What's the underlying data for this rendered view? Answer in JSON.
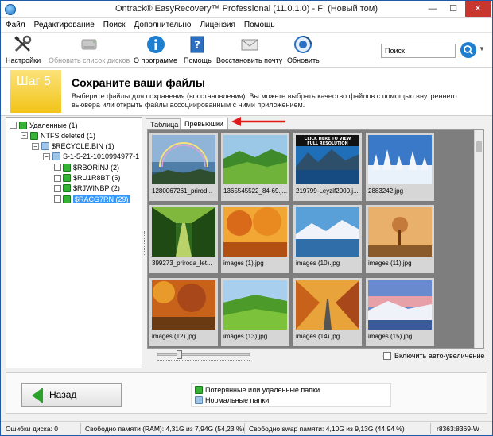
{
  "window": {
    "title": "Ontrack® EasyRecovery™ Professional (11.0.1.0) - F: (Новый том)",
    "min": "—",
    "max": "☐",
    "close": "✕"
  },
  "menu": [
    "Файл",
    "Редактирование",
    "Поиск",
    "Дополнительно",
    "Лицензия",
    "Помощь"
  ],
  "toolbar": {
    "items": [
      {
        "label": "Настройки",
        "icon": "wrench-screwdriver-icon",
        "enabled": true
      },
      {
        "label": "Обновить список дисков",
        "icon": "disk-drive-icon",
        "enabled": false
      },
      {
        "label": "О программе",
        "icon": "info-icon",
        "enabled": true
      },
      {
        "label": "Помощь",
        "icon": "help-book-icon",
        "enabled": true
      },
      {
        "label": "Восстановить почту",
        "icon": "envelope-icon",
        "enabled": true
      },
      {
        "label": "Обновить",
        "icon": "update-globe-icon",
        "enabled": true
      }
    ],
    "search_placeholder": "Поиск"
  },
  "step": {
    "badge": "Шаг 5",
    "title": "Сохраните ваши файлы",
    "description": "Выберите файлы для сохранения (восстановления). Вы можете выбрать качество файлов с помощью внутреннего вьювера или открыть файлы ассоциированным с ними приложением."
  },
  "tree": [
    {
      "label": "Удаленные (1)",
      "level": 0,
      "expander": "−",
      "color": "green",
      "checkbox": false,
      "selected": false
    },
    {
      "label": "NTFS deleted (1)",
      "level": 1,
      "expander": "−",
      "color": "green",
      "checkbox": false,
      "selected": false
    },
    {
      "label": "$RECYCLE.BIN (1)",
      "level": 2,
      "expander": "−",
      "color": "blue",
      "checkbox": false,
      "selected": false
    },
    {
      "label": "S-1-5-21-1010994977-1",
      "level": 3,
      "expander": "−",
      "color": "blue",
      "checkbox": false,
      "selected": false
    },
    {
      "label": "$RBORINJ (2)",
      "level": 4,
      "expander": "",
      "color": "green",
      "checkbox": true,
      "selected": false
    },
    {
      "label": "$RU1R8BT (5)",
      "level": 4,
      "expander": "",
      "color": "green",
      "checkbox": true,
      "selected": false
    },
    {
      "label": "$RJWINBP (2)",
      "level": 4,
      "expander": "",
      "color": "green",
      "checkbox": true,
      "selected": false
    },
    {
      "label": "$RACG7RN (29)",
      "level": 4,
      "expander": "",
      "color": "green",
      "checkbox": true,
      "selected": true
    }
  ],
  "tabs": [
    {
      "label": "Таблица",
      "active": false
    },
    {
      "label": "Превьюшки",
      "active": true
    }
  ],
  "thumbnails": [
    {
      "name": "1280067261_prirod...",
      "scene": "lake-rainbow"
    },
    {
      "name": "1365545522_84-69.j...",
      "scene": "green-valley"
    },
    {
      "name": "219799-Leyzif2000.j...",
      "scene": "lake-mountains-banner"
    },
    {
      "name": "2883242.jpg",
      "scene": "snow-forest"
    },
    {
      "name": "399273_priroda_let...",
      "scene": "tree-alley"
    },
    {
      "name": "images (1).jpg",
      "scene": "autumn-trees"
    },
    {
      "name": "images (10).jpg",
      "scene": "winter-lake"
    },
    {
      "name": "images (11).jpg",
      "scene": "misty-tree"
    },
    {
      "name": "images (12).jpg",
      "scene": "autumn-forest"
    },
    {
      "name": "images (13).jpg",
      "scene": "green-hills"
    },
    {
      "name": "images (14).jpg",
      "scene": "autumn-road"
    },
    {
      "name": "images (15).jpg",
      "scene": "snowy-sunset"
    }
  ],
  "banner_overlay": [
    "CLICK HERE TO VIEW",
    "FULL RESOLUTION"
  ],
  "zoom_slider_value": 0.22,
  "auto_zoom_label": "Включить авто-увеличение",
  "back_button": "Назад",
  "legend": [
    {
      "label": "Потерянные или удаленные папки",
      "color": "green"
    },
    {
      "label": "Нормальные папки",
      "color": "blue"
    }
  ],
  "status": {
    "disk_errors": "Ошибки диска: 0",
    "ram": "Свободно памяти (RAM): 4,31G из 7,94G (54,23 %)",
    "swap": "Свободно swap памяти: 4,10G из 9,13G (44,94 %)",
    "build": "r8363:8369-W"
  },
  "colors": {
    "accent": "#1e7fd0",
    "step_yellow": "#f2c417",
    "annotation_arrow": "#e0191a",
    "selection": "#3399ff"
  }
}
